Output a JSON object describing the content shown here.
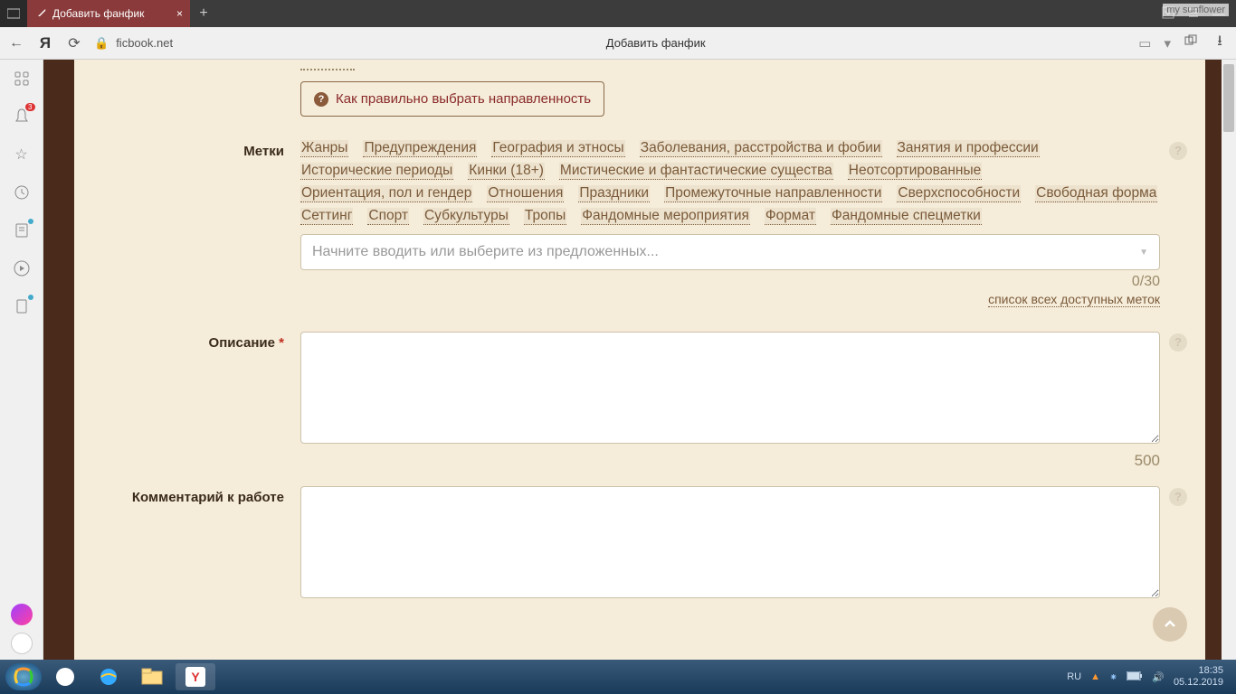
{
  "browser": {
    "tab_title": "Добавить фанфик",
    "url_domain": "ficbook.net",
    "page_title_addr": "Добавить фанфик",
    "watermark": "my sunflower"
  },
  "sidebar": {
    "notif_badge": "3"
  },
  "form": {
    "direction_hint": "Как правильно выбрать направленность",
    "tags_label": "Метки",
    "tag_links": [
      "Жанры",
      "Предупреждения",
      "География и этносы",
      "Заболевания, расстройства и фобии",
      "Занятия и профессии",
      "Исторические периоды",
      "Кинки (18+)",
      "Мистические и фантастические существа",
      "Неотсортированные",
      "Ориентация, пол и гендер",
      "Отношения",
      "Праздники",
      "Промежуточные направленности",
      "Сверхспособности",
      "Свободная форма",
      "Сеттинг",
      "Спорт",
      "Субкультуры",
      "Тропы",
      "Фандомные мероприятия",
      "Формат",
      "Фандомные спецметки"
    ],
    "tags_placeholder": "Начните вводить или выберите из предложенных...",
    "tags_counter": "0/30",
    "all_tags_link": "список всех доступных меток",
    "description_label": "Описание",
    "description_limit": "500",
    "comment_label": "Комментарий к работе"
  },
  "taskbar": {
    "lang": "RU",
    "time": "18:35",
    "date": "05.12.2019"
  }
}
